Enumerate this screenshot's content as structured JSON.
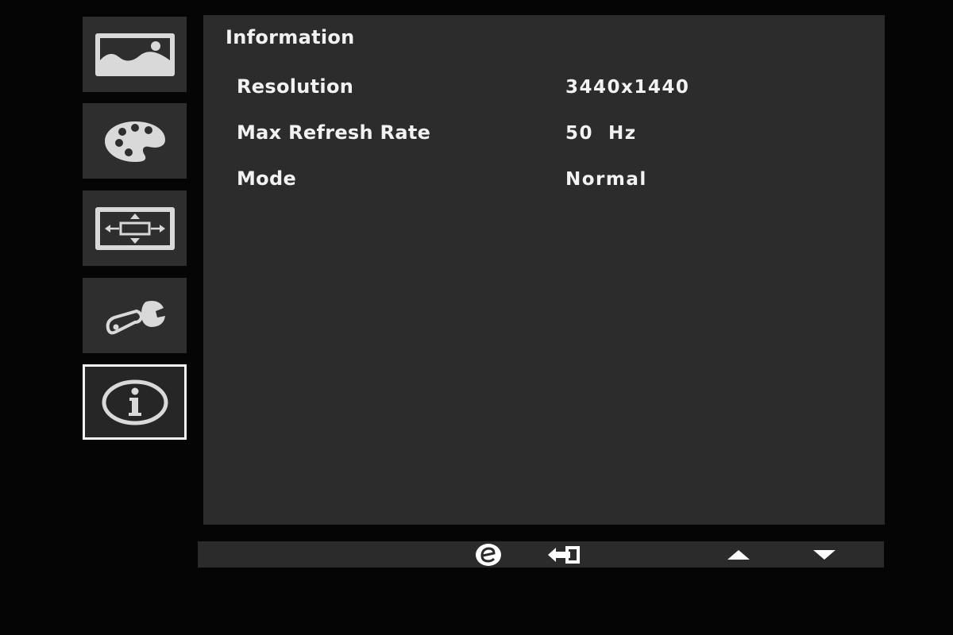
{
  "sidebar": {
    "items": [
      {
        "icon": "picture-icon",
        "selected": false
      },
      {
        "icon": "palette-icon",
        "selected": false
      },
      {
        "icon": "display-position-icon",
        "selected": false
      },
      {
        "icon": "wrench-settings-icon",
        "selected": false
      },
      {
        "icon": "information-icon",
        "selected": true
      }
    ]
  },
  "panel": {
    "title": "Information",
    "rows": [
      {
        "label": "Resolution",
        "value": "3440x1440"
      },
      {
        "label": "Max Refresh Rate",
        "value": "50  Hz"
      },
      {
        "label": "Mode",
        "value": "Normal"
      }
    ]
  },
  "bottom_bar": {
    "buttons": [
      "e-key-icon",
      "exit-icon",
      "up-arrow-icon",
      "down-arrow-icon"
    ]
  },
  "colors": {
    "background": "#050505",
    "panel": "#2c2c2c",
    "tile": "#2e2e2e",
    "icon": "#d9d9d9",
    "text": "#f2f2f2"
  }
}
